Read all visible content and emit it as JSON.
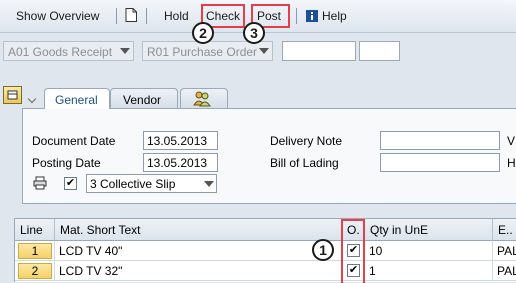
{
  "toolbar": {
    "show_overview": "Show Overview",
    "hold": "Hold",
    "check": "Check",
    "post": "Post",
    "help": "Help",
    "new_doc_icon": "document-icon",
    "help_icon": "info-icon"
  },
  "callouts": {
    "one": "1",
    "two": "2",
    "three": "3"
  },
  "selectors": {
    "transaction": "A01 Goods Receipt",
    "reference": "R01 Purchase Order"
  },
  "tabs": [
    "General",
    "Vendor"
  ],
  "header": {
    "document_date_label": "Document Date",
    "document_date": "13.05.2013",
    "posting_date_label": "Posting Date",
    "posting_date": "13.05.2013",
    "delivery_note_label": "Delivery Note",
    "bill_of_lading_label": "Bill of Lading",
    "right_label_1": "V",
    "right_label_2": "H",
    "slip": "3 Collective Slip",
    "print_checked": true
  },
  "table": {
    "columns": [
      "Line",
      "Mat. Short Text",
      "O.",
      "Qty in UnE",
      "E.."
    ],
    "rows": [
      {
        "line": "1",
        "text": "LCD TV 40\"",
        "ok": true,
        "qty": "10",
        "unit": "PAL"
      },
      {
        "line": "2",
        "text": "LCD TV 32\"",
        "ok": true,
        "qty": "1",
        "unit": "PAL"
      }
    ]
  },
  "colors": {
    "highlight": "#e0414a",
    "accent_tab": "#1f4e8c"
  }
}
